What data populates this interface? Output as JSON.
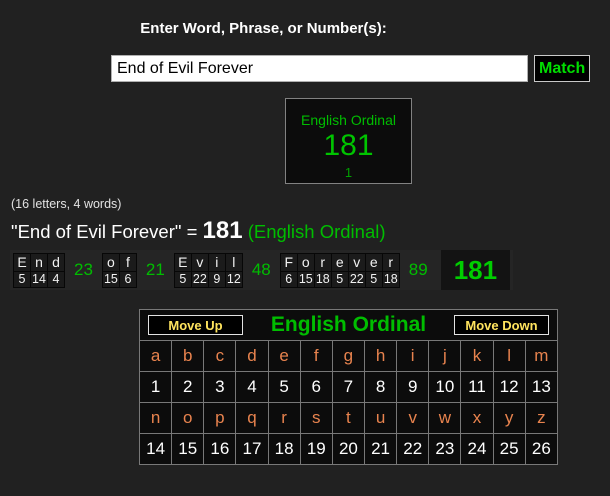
{
  "header": {
    "title": "Enter Word, Phrase, or Number(s):"
  },
  "search": {
    "value": "End of Evil Forever",
    "match_label": "Match"
  },
  "result_box": {
    "cipher": "English Ordinal",
    "value": "181",
    "count": "1"
  },
  "stats": "(16 letters, 4 words)",
  "equation": {
    "phrase": "\"End of Evil Forever\"",
    "equals": " = ",
    "value": "181",
    "cipher": " (English Ordinal)"
  },
  "breakdown": {
    "words": [
      {
        "letters": [
          "E",
          "n",
          "d"
        ],
        "values": [
          5,
          14,
          4
        ],
        "subtotal": 23
      },
      {
        "letters": [
          "o",
          "f"
        ],
        "values": [
          15,
          6
        ],
        "subtotal": 21
      },
      {
        "letters": [
          "E",
          "v",
          "i",
          "l"
        ],
        "values": [
          5,
          22,
          9,
          12
        ],
        "subtotal": 48
      },
      {
        "letters": [
          "F",
          "o",
          "r",
          "e",
          "v",
          "e",
          "r"
        ],
        "values": [
          6,
          15,
          18,
          5,
          22,
          5,
          18
        ],
        "subtotal": 89
      }
    ],
    "total": "181"
  },
  "cipher_table": {
    "move_up_label": "Move Up",
    "title": "English Ordinal",
    "move_down_label": "Move Down",
    "rows": [
      [
        "a",
        "b",
        "c",
        "d",
        "e",
        "f",
        "g",
        "h",
        "i",
        "j",
        "k",
        "l",
        "m"
      ],
      [
        "1",
        "2",
        "3",
        "4",
        "5",
        "6",
        "7",
        "8",
        "9",
        "10",
        "11",
        "12",
        "13"
      ],
      [
        "n",
        "o",
        "p",
        "q",
        "r",
        "s",
        "t",
        "u",
        "v",
        "w",
        "x",
        "y",
        "z"
      ],
      [
        "14",
        "15",
        "16",
        "17",
        "18",
        "19",
        "20",
        "21",
        "22",
        "23",
        "24",
        "25",
        "26"
      ]
    ]
  },
  "colors": {
    "background": "#212121",
    "green": "#00bd00",
    "orange": "#e8834e",
    "yellow": "#ffe45e",
    "cell_bg": "#0c0c0c"
  }
}
